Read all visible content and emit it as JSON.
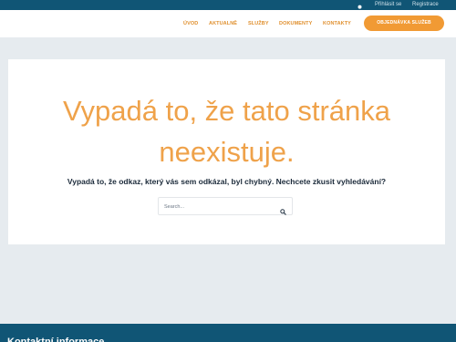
{
  "topbar": {
    "user_icon": "user-icon",
    "login_label": "Přihlásit se",
    "register_label": "Registrace"
  },
  "nav": {
    "items": [
      "ÚVOD",
      "AKTUALNĚ",
      "SLUŽBY",
      "DOKUMENTY",
      "KONTAKTY"
    ],
    "cta_label": "OBJEDNÁVKA SLUŽEB"
  },
  "main": {
    "headline_line1": "Vypadá to, že tato stránka",
    "headline_line2": "neexistuje.",
    "subtitle": "Vypadá to, že odkaz, který vás sem odkázal, byl chybný. Nechcete zkusit vyhledávání?",
    "search": {
      "placeholder": "Search...",
      "icon": "search-icon"
    }
  },
  "footer": {
    "heading": "Kontaktní informace"
  },
  "colors": {
    "topbar_bg": "#105575",
    "accent": "#f19a34",
    "headline": "#efa24a",
    "page_bg": "#e6ebef"
  }
}
